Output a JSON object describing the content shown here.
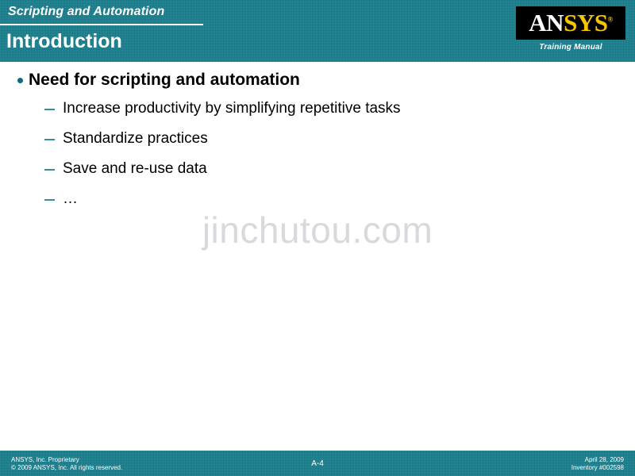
{
  "header": {
    "kicker": "Scripting and Automation",
    "title": "Introduction",
    "band_color": "#157d8c",
    "rule_color": "#ffffff"
  },
  "logo": {
    "word_first": "AN",
    "word_second": "SYS",
    "registered_mark": "®",
    "caption": "Training Manual",
    "box_color": "#000000",
    "first_color": "#ffffff",
    "second_color": "#f5c500"
  },
  "body": {
    "bullet": {
      "marker": "bullet-dot",
      "text": "Need for scripting and automation",
      "marker_color": "#0f6b7a"
    },
    "subitems": [
      {
        "marker": "en-dash",
        "text": "Increase productivity by simplifying repetitive tasks"
      },
      {
        "marker": "en-dash",
        "text": "Standardize practices"
      },
      {
        "marker": "en-dash",
        "text": "Save and re-use data"
      },
      {
        "marker": "en-dash",
        "text": "…"
      }
    ],
    "subitem_marker_color": "#3b8c99"
  },
  "watermark": {
    "text": "jinchutou.com",
    "color": "#d7d9dd"
  },
  "footer": {
    "proprietary_line1": "ANSYS, Inc. Proprietary",
    "proprietary_line2": "© 2009 ANSYS, Inc.  All rights reserved.",
    "page_number": "A-4",
    "date": "April 28, 2009",
    "inventory": "Inventory #002598",
    "band_color": "#157d8c"
  }
}
